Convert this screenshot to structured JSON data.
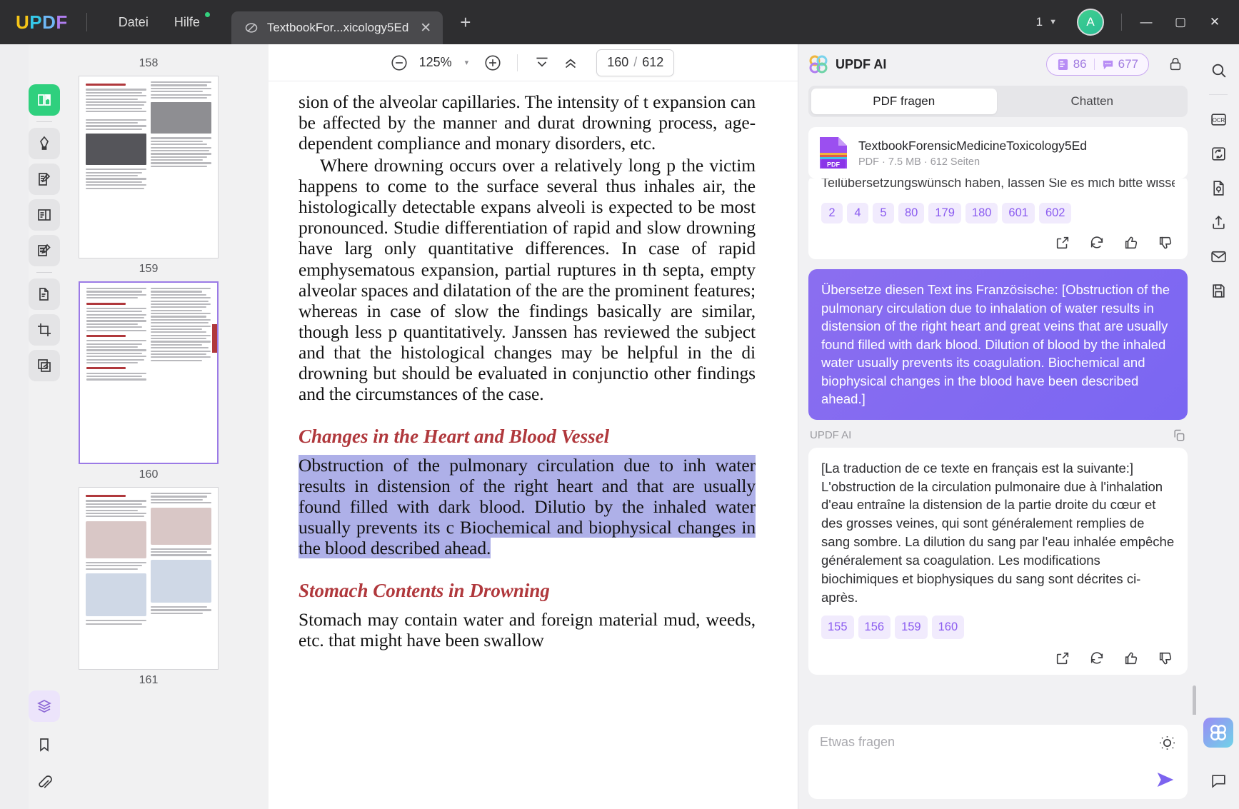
{
  "titlebar": {
    "logo_parts": [
      "U",
      "P",
      "D",
      "F"
    ],
    "menus": [
      {
        "label": "Datei",
        "has_dot": false
      },
      {
        "label": "Hilfe",
        "has_dot": true
      }
    ],
    "tab": {
      "title": "TextbookFor...xicology5Ed",
      "close": "✕",
      "icon": "pdf-slash-icon"
    },
    "new_tab": "+",
    "window_count": "1",
    "avatar_initial": "A",
    "minimize": "—",
    "maximize": "▢",
    "close": "✕"
  },
  "left_rail": {
    "tools": [
      {
        "name": "reader-tool",
        "active": true
      },
      {
        "name": "highlighter-tool",
        "active": false
      },
      {
        "name": "edit-pdf-tool",
        "active": false
      },
      {
        "name": "organize-pages-tool",
        "active": false
      },
      {
        "name": "annotate-tool",
        "active": false
      },
      {
        "name": "convert-tool",
        "active": false
      },
      {
        "name": "crop-tool",
        "active": false
      },
      {
        "name": "compare-tool",
        "active": false
      }
    ],
    "bottom": [
      {
        "name": "layers-tool",
        "active": true
      },
      {
        "name": "bookmark-tool",
        "active": false
      },
      {
        "name": "attachment-tool",
        "active": false
      }
    ]
  },
  "thumbnails": {
    "pages": [
      {
        "number": "158",
        "active": false
      },
      {
        "number": "159",
        "active": false
      },
      {
        "number": "160",
        "active": true
      },
      {
        "number": "161",
        "active": false
      }
    ]
  },
  "viewer_toolbar": {
    "zoom_out": "−",
    "zoom_value": "125%",
    "zoom_caret": "▾",
    "zoom_in": "+",
    "fit_page_icon": "fit-page-icon",
    "scroll_up_icon": "scroll-up-icon",
    "current_page": "160",
    "page_separator": "/",
    "total_pages": "612"
  },
  "document": {
    "paragraphs": [
      "sion of the alveolar capillaries. The intensity of t expansion can be affected by the manner and durat drowning process, age-dependent compliance and monary disorders, etc.",
      "Where drowning occurs over a relatively long p the victim happens to come to the surface several thus inhales air, the histologically detectable expans alveoli is expected to be most pronounced. Studie differentiation of rapid and slow drowning have larg only quantitative differences. In case of rapid emphysematous expansion, partial ruptures in th septa, empty alveolar spaces and dilatation of the are the prominent features; whereas in case of slow the findings basically are similar, though less p quantitatively. Janssen has reviewed the subject and that the histological changes may be helpful in the di drowning but should be evaluated in conjunctio other findings and the circumstances of the case."
    ],
    "heading1": "Changes in the Heart and Blood Vessel",
    "highlighted": "Obstruction of the pulmonary circulation due to inh water results in distension of the right heart and that are usually found filled with dark blood. Dilutio by the inhaled water usually prevents its c Biochemical and biophysical changes in the blood described ahead.",
    "heading2": "Stomach Contents in Drowning",
    "paragraph_after": "Stomach may contain water and foreign material mud, weeds, etc. that might have been swallow"
  },
  "ai_panel": {
    "title": "UPDF AI",
    "badges": [
      {
        "icon": "document-pages-icon",
        "value": "86"
      },
      {
        "icon": "chat-bubble-icon",
        "value": "677"
      }
    ],
    "lock_icon": "lock-icon",
    "tabs": [
      {
        "label": "PDF fragen",
        "active": true
      },
      {
        "label": "Chatten",
        "active": false
      }
    ],
    "file_card": {
      "name": "TextbookForensicMedicineToxicology5Ed",
      "meta": "PDF · 7.5 MB · 612 Seiten",
      "icon_label": "PDF"
    },
    "previous_message": {
      "clipped_text": "Teilübersetzungswünsch haben, lassen Sie es mich bitte wissen.",
      "page_chips": [
        "2",
        "4",
        "5",
        "80",
        "179",
        "180",
        "601",
        "602"
      ],
      "actions": [
        "open-external-icon",
        "regenerate-icon",
        "thumbs-up-icon",
        "thumbs-down-icon"
      ]
    },
    "user_message": "Übersetze diesen Text ins Französische: [Obstruction of the pulmonary circulation due to inhalation of\nwater results in distension of the right heart and great veins that are usually found filled with dark blood. Dilution of blood by the inhaled water usually prevents its coagulation. Biochemical and biophysical changes in the blood have been described ahead.]",
    "assistant_label": "UPDF AI",
    "copy_icon": "copy-icon",
    "assistant_message": "[La traduction de ce texte en français est la suivante:] L'obstruction de la circulation pulmonaire due à l'inhalation d'eau entraîne la distension de la partie droite du cœur et des grosses veines, qui sont généralement remplies de sang sombre. La dilution du sang par l'eau inhalée empêche généralement sa coagulation. Les modifications biochimiques et biophysiques du sang sont décrites ci-après.",
    "assistant_page_chips": [
      "155",
      "156",
      "159",
      "160"
    ],
    "assistant_actions": [
      "open-external-icon",
      "regenerate-icon",
      "thumbs-up-icon",
      "thumbs-down-icon"
    ],
    "composer": {
      "placeholder": "Etwas fragen",
      "bulb_icon": "lightbulb-icon",
      "send_icon": "send-icon"
    }
  },
  "right_rail": {
    "tools": [
      {
        "name": "search-icon"
      },
      {
        "name": "ocr-icon"
      },
      {
        "name": "sync-convert-icon"
      },
      {
        "name": "protect-page-icon"
      },
      {
        "name": "share-icon"
      },
      {
        "name": "email-icon"
      },
      {
        "name": "save-as-icon"
      }
    ],
    "ai_assistant": "ai-assistant-icon",
    "chat_support": "chat-support-icon"
  },
  "colors": {
    "accent_purple": "#8b5cf0",
    "user_bubble": "#7e68f0",
    "heading_red": "#b0383c",
    "highlight": "#aeb0e8",
    "active_tool_green": "#2fd07e"
  }
}
